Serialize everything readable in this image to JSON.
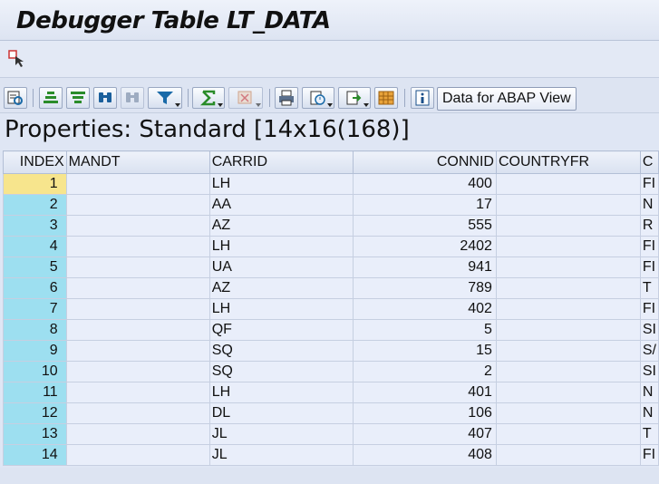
{
  "window": {
    "title": "Debugger Table LT_DATA"
  },
  "toolbar": {
    "icons": [
      "details-icon",
      "sort-ascending-icon",
      "sort-descending-icon",
      "find-icon",
      "find-next-icon",
      "filter-icon",
      "sum-icon",
      "subtotals-icon",
      "print-icon",
      "views-icon",
      "export-icon",
      "layout-icon",
      "info-icon"
    ],
    "abap_view_label": "Data for ABAP View"
  },
  "properties": {
    "text": "Properties: Standard [14x16(168)]"
  },
  "table": {
    "columns": [
      "INDEX",
      "MANDT",
      "CARRID",
      "CONNID",
      "COUNTRYFR",
      "C"
    ],
    "rows": [
      {
        "index": "1",
        "mandt": "",
        "carrid": "LH",
        "connid": "400",
        "countryfr": "",
        "next": "FI"
      },
      {
        "index": "2",
        "mandt": "",
        "carrid": "AA",
        "connid": "17",
        "countryfr": "",
        "next": "N"
      },
      {
        "index": "3",
        "mandt": "",
        "carrid": "AZ",
        "connid": "555",
        "countryfr": "",
        "next": "R"
      },
      {
        "index": "4",
        "mandt": "",
        "carrid": "LH",
        "connid": "2402",
        "countryfr": "",
        "next": "FI"
      },
      {
        "index": "5",
        "mandt": "",
        "carrid": "UA",
        "connid": "941",
        "countryfr": "",
        "next": "FI"
      },
      {
        "index": "6",
        "mandt": "",
        "carrid": "AZ",
        "connid": "789",
        "countryfr": "",
        "next": "T"
      },
      {
        "index": "7",
        "mandt": "",
        "carrid": "LH",
        "connid": "402",
        "countryfr": "",
        "next": "FI"
      },
      {
        "index": "8",
        "mandt": "",
        "carrid": "QF",
        "connid": "5",
        "countryfr": "",
        "next": "SI"
      },
      {
        "index": "9",
        "mandt": "",
        "carrid": "SQ",
        "connid": "15",
        "countryfr": "",
        "next": "S/"
      },
      {
        "index": "10",
        "mandt": "",
        "carrid": "SQ",
        "connid": "2",
        "countryfr": "",
        "next": "SI"
      },
      {
        "index": "11",
        "mandt": "",
        "carrid": "LH",
        "connid": "401",
        "countryfr": "",
        "next": "N"
      },
      {
        "index": "12",
        "mandt": "",
        "carrid": "DL",
        "connid": "106",
        "countryfr": "",
        "next": "N"
      },
      {
        "index": "13",
        "mandt": "",
        "carrid": "JL",
        "connid": "407",
        "countryfr": "",
        "next": "T"
      },
      {
        "index": "14",
        "mandt": "",
        "carrid": "JL",
        "connid": "408",
        "countryfr": "",
        "next": "FI"
      }
    ]
  }
}
